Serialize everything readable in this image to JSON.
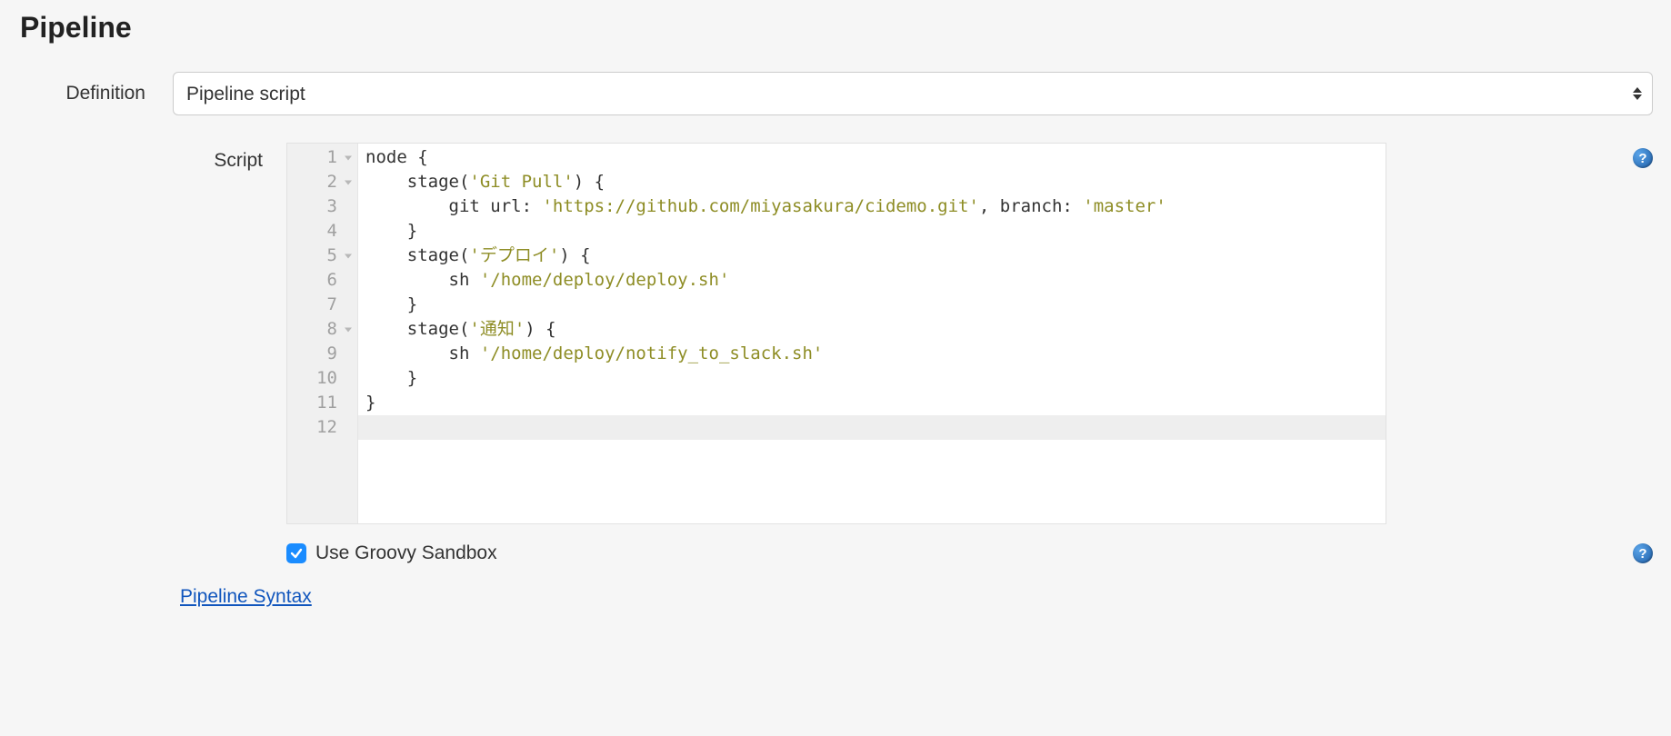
{
  "section": {
    "title": "Pipeline"
  },
  "definition": {
    "label": "Definition",
    "selected": "Pipeline script"
  },
  "script": {
    "label": "Script",
    "lines": [
      {
        "n": 1,
        "fold": true,
        "segments": [
          {
            "t": "node {",
            "c": "plain"
          }
        ]
      },
      {
        "n": 2,
        "fold": true,
        "segments": [
          {
            "t": "    stage(",
            "c": "plain"
          },
          {
            "t": "'Git Pull'",
            "c": "str"
          },
          {
            "t": ") {",
            "c": "plain"
          }
        ]
      },
      {
        "n": 3,
        "fold": false,
        "segments": [
          {
            "t": "        git url: ",
            "c": "plain"
          },
          {
            "t": "'https://github.com/miyasakura/cidemo.git'",
            "c": "str"
          },
          {
            "t": ", branch: ",
            "c": "plain"
          },
          {
            "t": "'master'",
            "c": "str"
          }
        ]
      },
      {
        "n": 4,
        "fold": false,
        "segments": [
          {
            "t": "    }",
            "c": "plain"
          }
        ]
      },
      {
        "n": 5,
        "fold": true,
        "segments": [
          {
            "t": "    stage(",
            "c": "plain"
          },
          {
            "t": "'デプロイ'",
            "c": "str"
          },
          {
            "t": ") {",
            "c": "plain"
          }
        ]
      },
      {
        "n": 6,
        "fold": false,
        "segments": [
          {
            "t": "        sh ",
            "c": "plain"
          },
          {
            "t": "'/home/deploy/deploy.sh'",
            "c": "str"
          }
        ]
      },
      {
        "n": 7,
        "fold": false,
        "segments": [
          {
            "t": "    }",
            "c": "plain"
          }
        ]
      },
      {
        "n": 8,
        "fold": true,
        "segments": [
          {
            "t": "    stage(",
            "c": "plain"
          },
          {
            "t": "'通知'",
            "c": "str"
          },
          {
            "t": ") {",
            "c": "plain"
          }
        ]
      },
      {
        "n": 9,
        "fold": false,
        "segments": [
          {
            "t": "        sh ",
            "c": "plain"
          },
          {
            "t": "'/home/deploy/notify_to_slack.sh'",
            "c": "str"
          }
        ]
      },
      {
        "n": 10,
        "fold": false,
        "segments": [
          {
            "t": "    }",
            "c": "plain"
          }
        ]
      },
      {
        "n": 11,
        "fold": false,
        "segments": [
          {
            "t": "}",
            "c": "plain"
          }
        ]
      },
      {
        "n": 12,
        "fold": false,
        "active": true,
        "segments": [
          {
            "t": "",
            "c": "plain"
          }
        ]
      }
    ]
  },
  "sandbox": {
    "checked": true,
    "label": "Use Groovy Sandbox"
  },
  "link": {
    "pipeline_syntax": "Pipeline Syntax"
  },
  "help_glyph": "?"
}
